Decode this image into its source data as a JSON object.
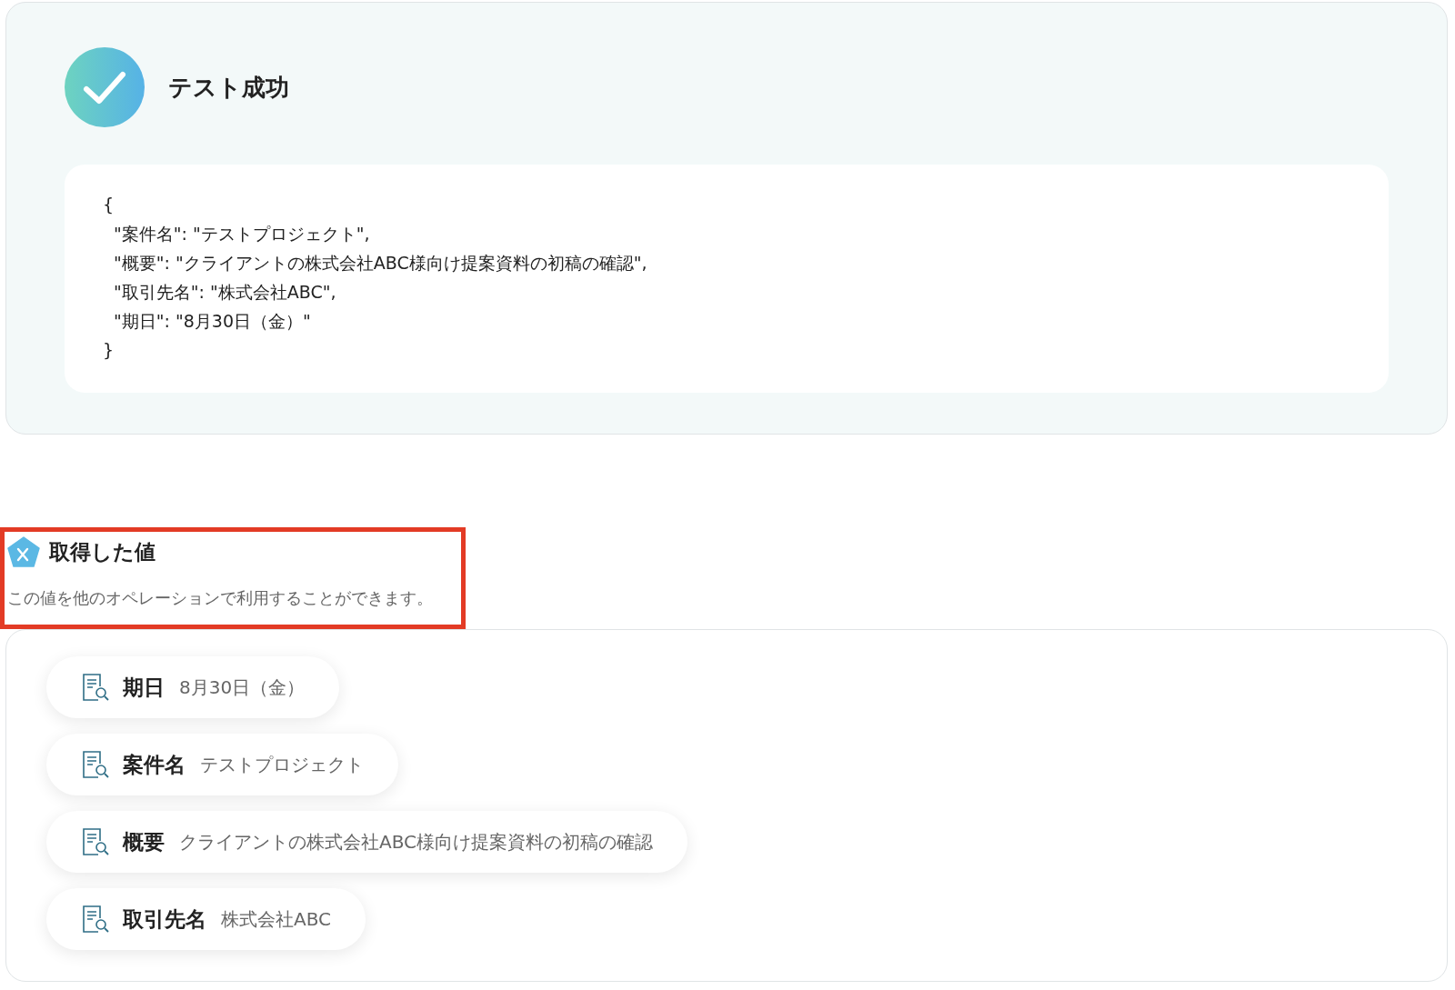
{
  "test_result": {
    "succeeded": true,
    "title": "テスト成功",
    "code_lines": [
      "{",
      "  \"案件名\": \"テストプロジェクト\",",
      "  \"概要\": \"クライアントの株式会社ABC様向け提案資料の初稿の確認\",",
      "  \"取引先名\": \"株式会社ABC\",",
      "  \"期日\": \"8月30日（金）\"",
      "}"
    ]
  },
  "acquired_values": {
    "title": "取得した値",
    "description": "この値を他のオペレーションで利用することができます。",
    "highlighted": true,
    "items": [
      {
        "label": "期日",
        "value": "8月30日（金）"
      },
      {
        "label": "案件名",
        "value": "テストプロジェクト"
      },
      {
        "label": "概要",
        "value": "クライアントの株式会社ABC様向け提案資料の初稿の確認"
      },
      {
        "label": "取引先名",
        "value": "株式会社ABC"
      }
    ]
  }
}
